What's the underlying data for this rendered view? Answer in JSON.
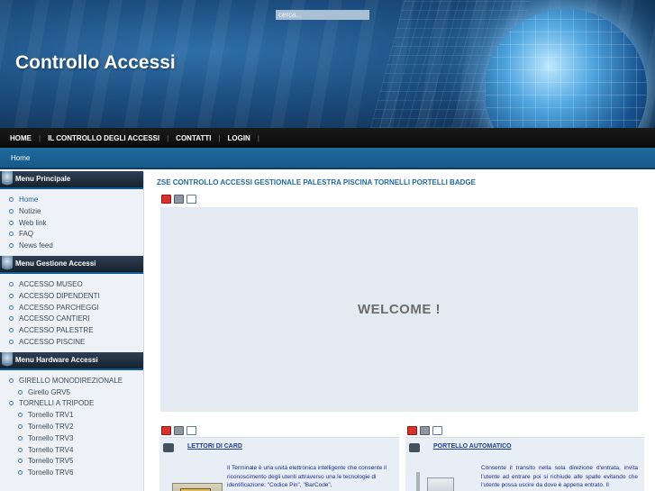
{
  "header": {
    "site_title": "Controllo Accessi",
    "search_placeholder": "cerca..."
  },
  "nav": {
    "items": [
      {
        "label": "HOME"
      },
      {
        "label": "IL CONTROLLO DEGLI ACCESSI"
      },
      {
        "label": "CONTATTI"
      },
      {
        "label": "LOGIN"
      }
    ],
    "separator": "|"
  },
  "breadcrumb": {
    "current": "Home"
  },
  "sidebar": {
    "menus": [
      {
        "title": "Menu Principale",
        "items": [
          "Home",
          "Notizie",
          "Web link",
          "FAQ",
          "News feed"
        ]
      },
      {
        "title": "Menu Gestione Accessi",
        "items": [
          "ACCESSO MUSEO",
          "ACCESSO DIPENDENTI",
          "ACCESSO PARCHEGGI",
          "ACCESSO CANTIERI",
          "ACCESSO PALESTRE",
          "ACCESSO PISCINE"
        ]
      },
      {
        "title": "Menu Hardware Accessi",
        "items": [
          "GIRELLO MONODIREZIONALE",
          "Girello GRV5",
          "TORNELLI A TRIPODE",
          "Tornello TRV1",
          "Tornello TRV2",
          "Tornello TRV3",
          "Tornello TRV4",
          "Tornello TRV5",
          "Tornello TRV6"
        ]
      }
    ]
  },
  "content": {
    "title": "ZSE CONTROLLO ACCESSI GESTIONALE PALESTRA PISCINA TORNELLI PORTELLI BADGE",
    "welcome": "WELCOME !",
    "cards": [
      {
        "title": "LETTORI DI CARD",
        "text": "Il Terminale è una unità elettronica intelligente che consente il riconoscimento degli utenti attraverso una le tecnologie di identificazione: \"Codice Pin\", \"BarCode\","
      },
      {
        "title": "PORTELLO AUTOMATICO",
        "text": "Consente il transito nella sola direzione d'entrata, invita l'utente ad entrare poi si richiude alle spalle evitando che l'utente possa uscire da dove è appena entrato. Il"
      }
    ]
  },
  "colors": {
    "nav_bg": "#111111",
    "breadcrumb_bg": "#1b6293",
    "title_blue": "#1e6aa6",
    "card_text": "#1d2a8f"
  },
  "icons": [
    "pdf-icon",
    "print-icon",
    "email-icon",
    "globe-icon",
    "menu-tag-icon",
    "bullet-icon"
  ]
}
